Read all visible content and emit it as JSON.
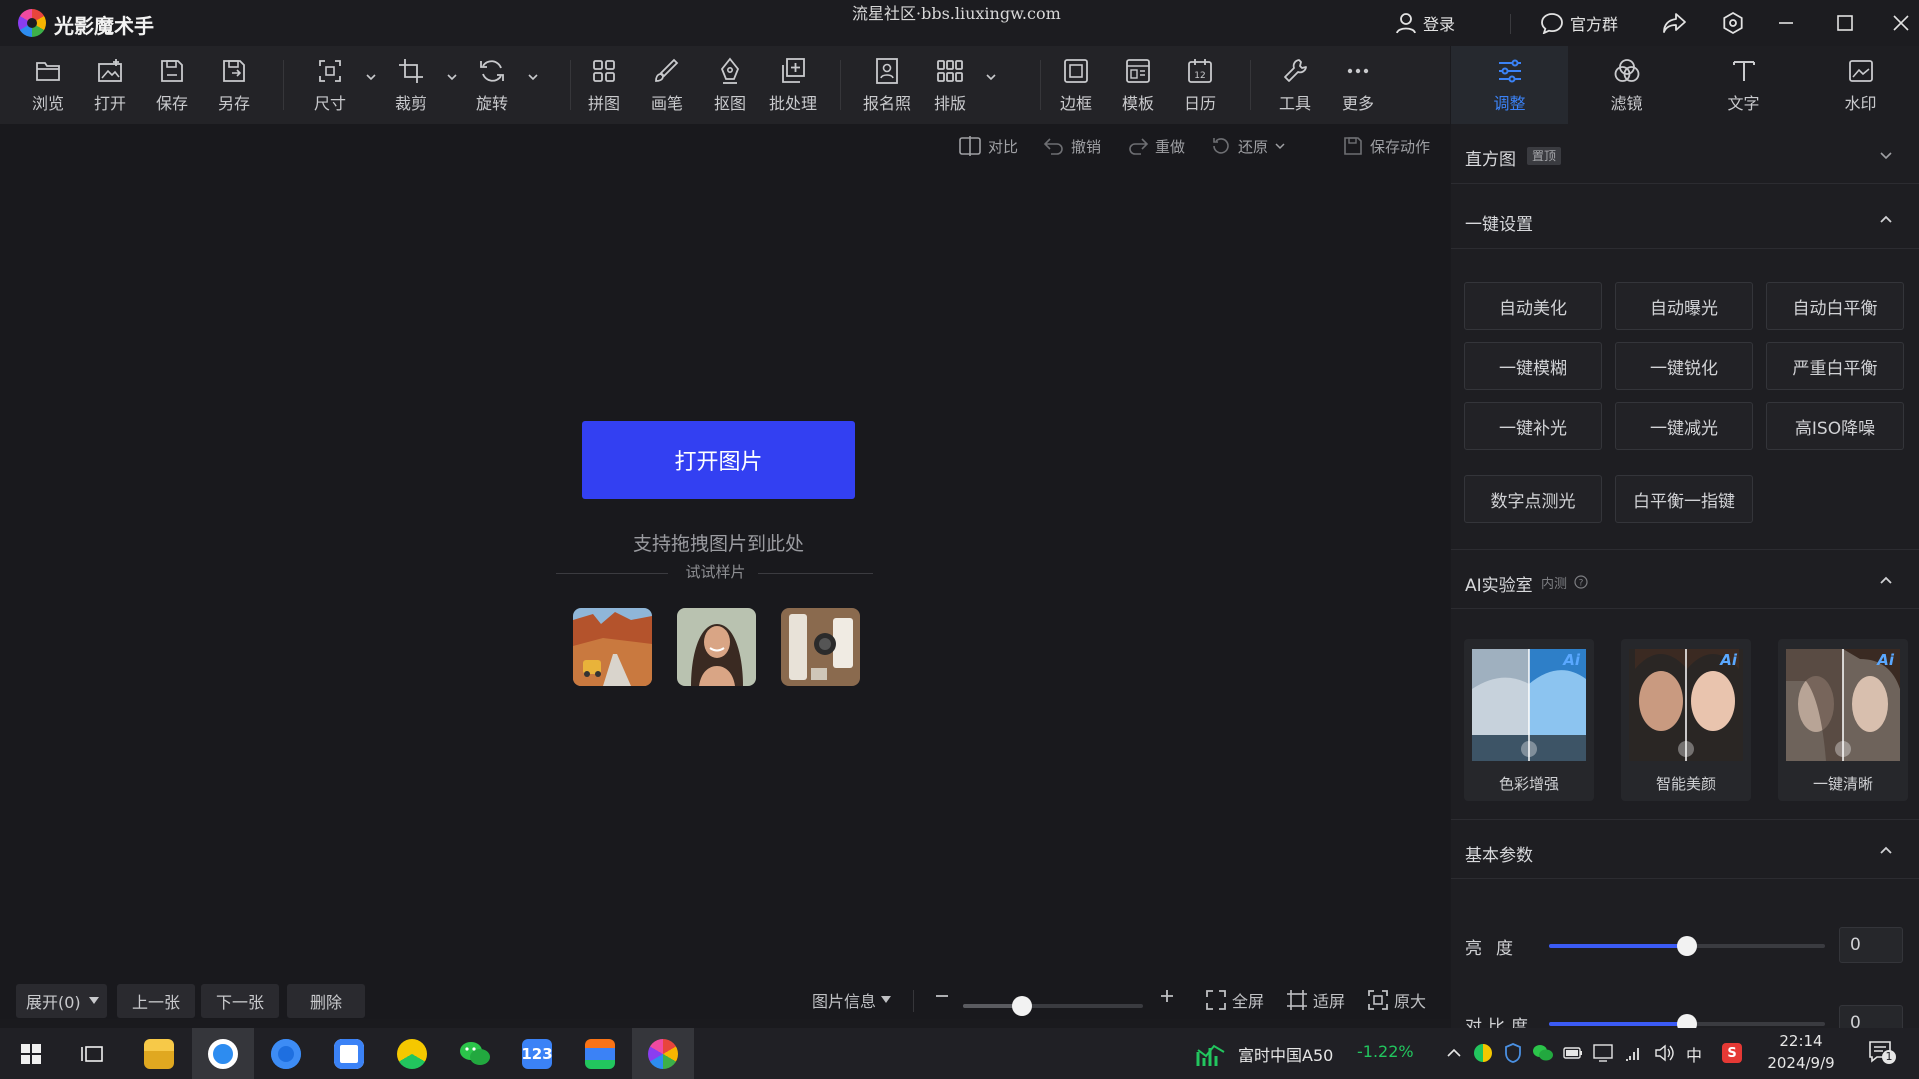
{
  "titlebar": {
    "app_name": "光影魔术手",
    "watermark": "流星社区·bbs.liuxingw.com",
    "login": "登录",
    "official_group": "官方群"
  },
  "toolbar": {
    "browse": "浏览",
    "open": "打开",
    "save": "保存",
    "save_as": "另存",
    "size": "尺寸",
    "crop": "裁剪",
    "rotate": "旋转",
    "collage": "拼图",
    "brush": "画笔",
    "cutout": "抠图",
    "batch": "批处理",
    "id_photo": "报名照",
    "layout": "排版",
    "border": "边框",
    "template": "模板",
    "calendar": "日历",
    "tools": "工具",
    "more": "更多"
  },
  "right_tabs": {
    "adjust": "调整",
    "filter": "滤镜",
    "text": "文字",
    "watermark": "水印"
  },
  "actions": {
    "compare": "对比",
    "undo": "撤销",
    "redo": "重做",
    "restore": "还原",
    "save_action": "保存动作"
  },
  "canvas": {
    "open_image": "打开图片",
    "drag_hint": "支持拖拽图片到此处",
    "samples_label": "试试样片"
  },
  "bottom": {
    "expand": "展开(0)",
    "prev": "上一张",
    "next": "下一张",
    "delete": "删除",
    "image_info": "图片信息",
    "fullscreen": "全屏",
    "fit": "适屏",
    "original": "原大",
    "zoom_fraction": 0.33
  },
  "panel": {
    "histogram": "直方图",
    "histogram_badge": "置顶",
    "one_click": "一键设置",
    "quick_buttons": [
      "自动美化",
      "自动曝光",
      "自动白平衡",
      "一键模糊",
      "一键锐化",
      "严重白平衡",
      "一键补光",
      "一键减光",
      "高ISO降噪",
      "数字点测光",
      "白平衡一指键"
    ],
    "ai_lab": "AI实验室",
    "ai_badge": "内测",
    "ai_tag": "Ai",
    "ai_cards": [
      "色彩增强",
      "智能美颜",
      "一键清晰"
    ],
    "basic_params": "基本参数",
    "brightness_label": "亮度",
    "brightness_value": "0",
    "brightness_fraction": 0.5,
    "contrast_label": "对比度",
    "contrast_value": "0",
    "contrast_fraction": 0.5
  },
  "taskbar": {
    "stock_name": "富时中国A50",
    "stock_change": "-1.22%",
    "ime": "中",
    "time": "22:14",
    "date": "2024/9/9",
    "notification_count": "1"
  },
  "colors": {
    "accent": "#3340f2",
    "slider_fill": "#3b5bf5",
    "active_tab": "#3b82f6",
    "stock_green": "#22c55e"
  }
}
